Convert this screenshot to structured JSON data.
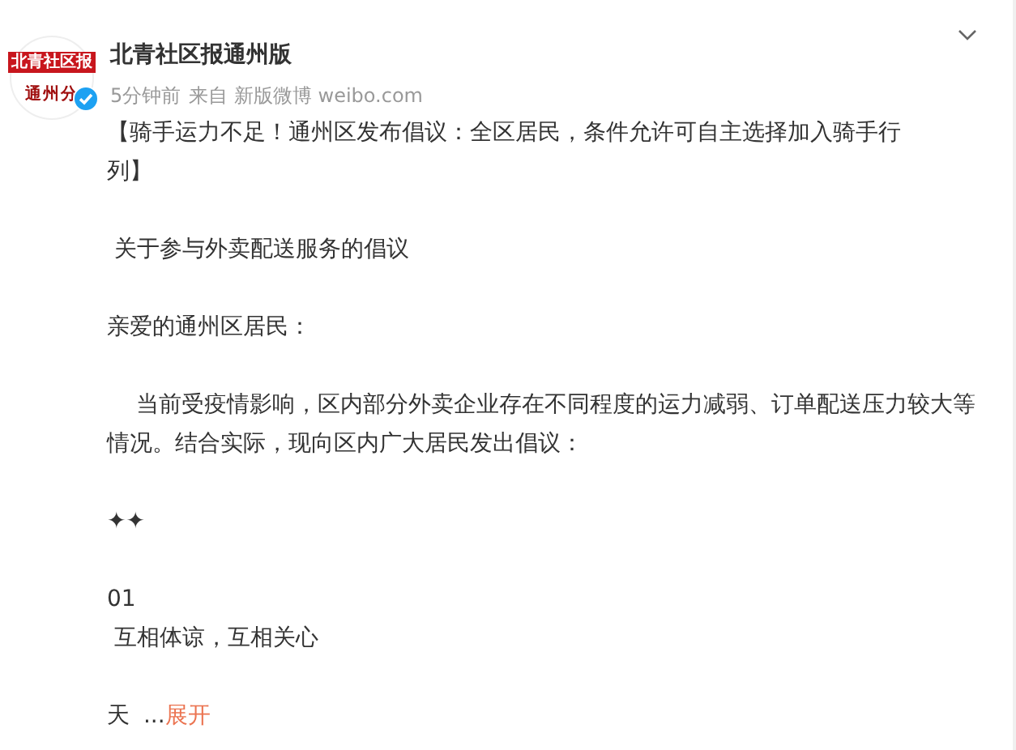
{
  "author": {
    "name": "北青社区报通州版",
    "avatar_logo": [
      "北青社区报",
      "通州分"
    ],
    "verified": true,
    "time": "5分钟前",
    "source": "来自 新版微博 weibo.com"
  },
  "body": [
    "【骑手运力不足！通州区发布倡议：全区居民，条件允许可自主选择加入骑手行列】",
    " 关于参与外卖配送服务的倡议",
    "亲爱的通州区居民：",
    "    当前受疫情影响，区内部分外卖企业存在不同程度的运力减弱、订单配送压力较大等情况。结合实际，现向区内广大居民发出倡议：",
    "✦✦",
    "01\n 互相体谅，互相关心"
  ],
  "truncated": {
    "text": "天 ",
    "ellipsis": "...",
    "expand_link": "展开"
  }
}
